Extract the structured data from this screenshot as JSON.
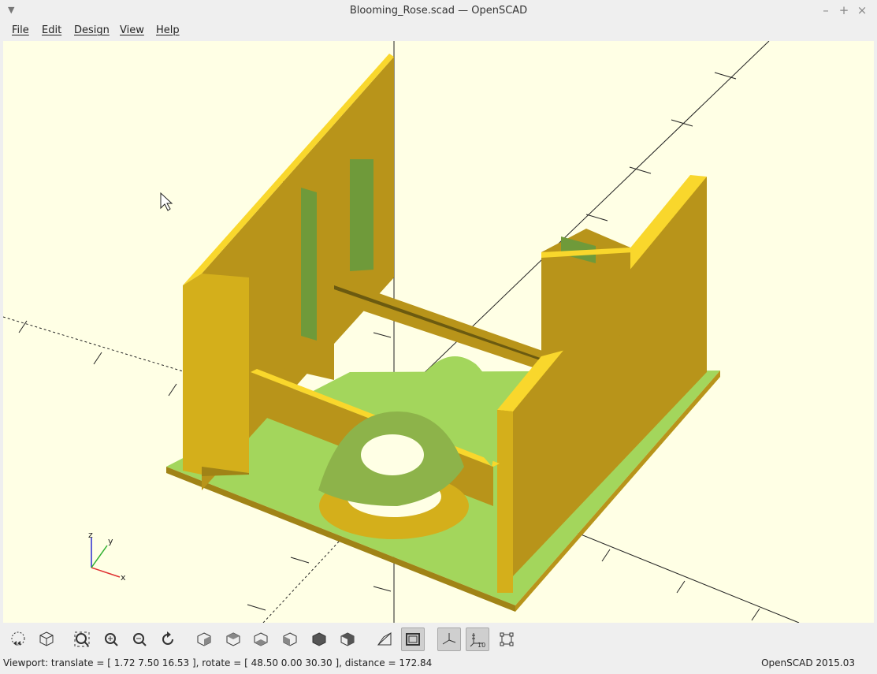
{
  "window": {
    "title": "Blooming_Rose.scad — OpenSCAD"
  },
  "menu": [
    {
      "label": "File"
    },
    {
      "label": "Edit"
    },
    {
      "label": "Design"
    },
    {
      "label": "View"
    },
    {
      "label": "Help"
    }
  ],
  "viewport": {
    "background": "#ffffe5",
    "axes_labels": {
      "x": "x",
      "y": "y",
      "z": "z"
    },
    "model_colors": {
      "face_light": "#f9d72c",
      "face_mid": "#d4af1b",
      "face_dark": "#b8941a",
      "base_green": "#a3d65c",
      "cut_green": "#6f9a3a"
    }
  },
  "toolbar": [
    {
      "icon": "preview-icon"
    },
    {
      "icon": "render-icon"
    },
    {
      "icon": "view-all-icon"
    },
    {
      "icon": "zoom-in-icon"
    },
    {
      "icon": "zoom-out-icon"
    },
    {
      "icon": "reset-view-icon"
    },
    {
      "icon": "view-right-icon"
    },
    {
      "icon": "view-top-icon"
    },
    {
      "icon": "view-bottom-icon"
    },
    {
      "icon": "view-left-icon"
    },
    {
      "icon": "view-front-icon"
    },
    {
      "icon": "view-back-icon"
    },
    {
      "icon": "perspective-icon"
    },
    {
      "icon": "orthogonal-icon"
    },
    {
      "icon": "show-axes-icon"
    },
    {
      "icon": "show-scale-markers-icon"
    },
    {
      "icon": "show-edges-icon"
    }
  ],
  "status": {
    "viewport": "Viewport: translate = [ 1.72 7.50 16.53 ], rotate = [ 48.50 0.00 30.30 ], distance = 172.84",
    "version": "OpenSCAD 2015.03"
  }
}
